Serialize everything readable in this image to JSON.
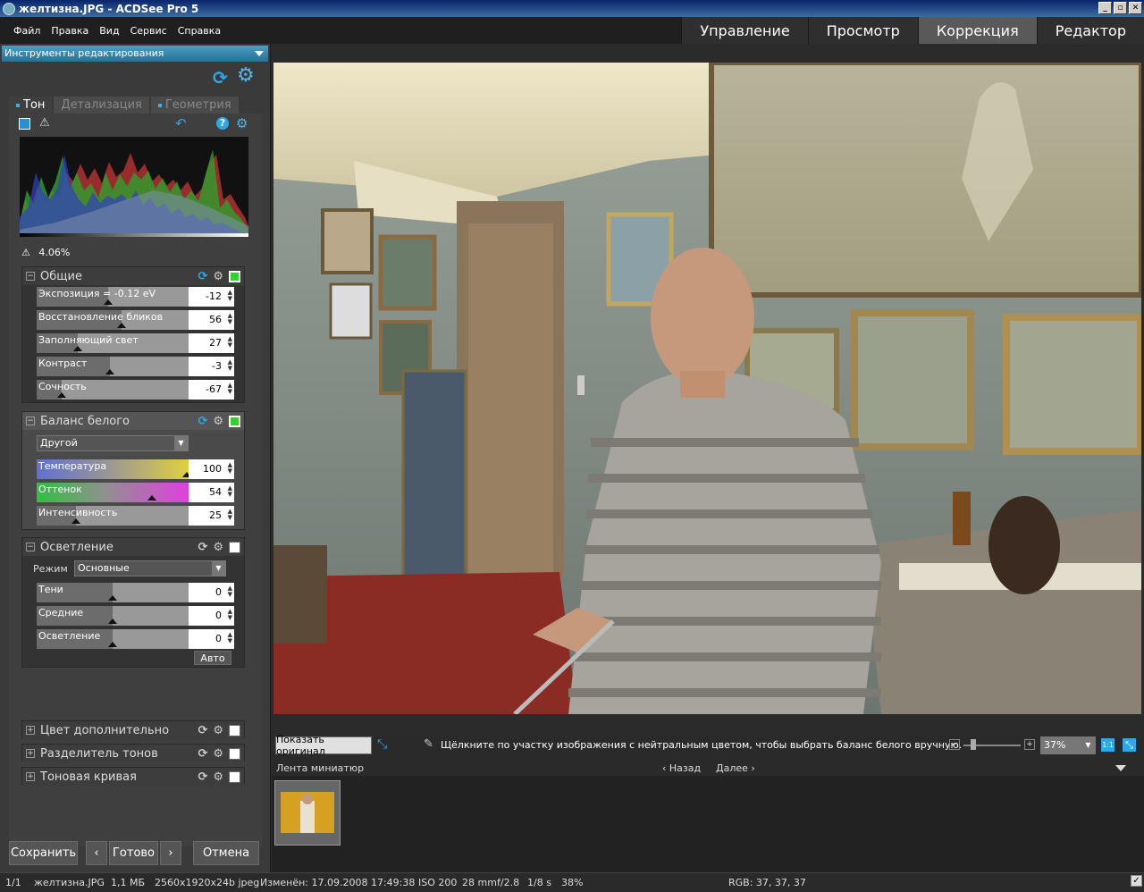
{
  "window": {
    "title": "желтизна.JPG - ACDSee Pro 5"
  },
  "menu": [
    "Файл",
    "Правка",
    "Вид",
    "Сервис",
    "Справка"
  ],
  "modes": [
    {
      "label": "Управление",
      "active": false
    },
    {
      "label": "Просмотр",
      "active": false
    },
    {
      "label": "Коррекция",
      "active": true
    },
    {
      "label": "Редактор",
      "active": false
    }
  ],
  "panel": {
    "header": "Инструменты редактирования",
    "tabs": [
      "Тон",
      "Детализация",
      "Геометрия"
    ],
    "clip_percent": "4.06%"
  },
  "general": {
    "title": "Общие",
    "sliders": [
      {
        "label": "Экспозиция = -0.12 eV",
        "value": "-12"
      },
      {
        "label": "Восстановление бликов",
        "value": "56"
      },
      {
        "label": "Заполняющий свет",
        "value": "27"
      },
      {
        "label": "Контраст",
        "value": "-3"
      },
      {
        "label": "Сочность",
        "value": "-67"
      }
    ]
  },
  "whitebalance": {
    "title": "Баланс белого",
    "preset": "Другой",
    "sliders": [
      {
        "label": "Температура",
        "value": "100"
      },
      {
        "label": "Оттенок",
        "value": "54"
      },
      {
        "label": "Интенсивность",
        "value": "25"
      }
    ]
  },
  "lighting": {
    "title": "Осветление",
    "mode_label": "Режим",
    "mode_value": "Основные",
    "sliders": [
      {
        "label": "Тени",
        "value": "0"
      },
      {
        "label": "Средние",
        "value": "0"
      },
      {
        "label": "Осветление",
        "value": "0"
      }
    ],
    "auto_label": "Авто"
  },
  "collapsed_sections": [
    "Цвет дополнительно",
    "Разделитель тонов",
    "Тоновая кривая"
  ],
  "buttons": {
    "save": "Сохранить",
    "done": "Готово",
    "cancel": "Отмена"
  },
  "viewbar": {
    "show_original": "Показать оригинал",
    "hint": "Щёлкните по участку изображения с нейтральным цветом, чтобы выбрать баланс белого вручную.",
    "zoom": "37%",
    "one_to_one": "1:1"
  },
  "filmstrip": {
    "title": "Лента миниатюр",
    "back": "Назад",
    "next": "Далее"
  },
  "status": {
    "index": "1/1",
    "filename": "желтизна.JPG",
    "size": "1,1 МБ",
    "dims": "2560x1920x24b jpeg",
    "modified": "Изменён: 17.09.2008 17:49:38",
    "iso": "ISO 200",
    "focal": "28 mm",
    "aperture": "f/2.8",
    "shutter": "1/8 s",
    "zoom": "38%",
    "rgb": "RGB: 37, 37, 37"
  },
  "colors": {
    "accent": "#2aa8e8",
    "active_checkbox": "#2cd42c",
    "panel_header": "#4a9fc4"
  }
}
